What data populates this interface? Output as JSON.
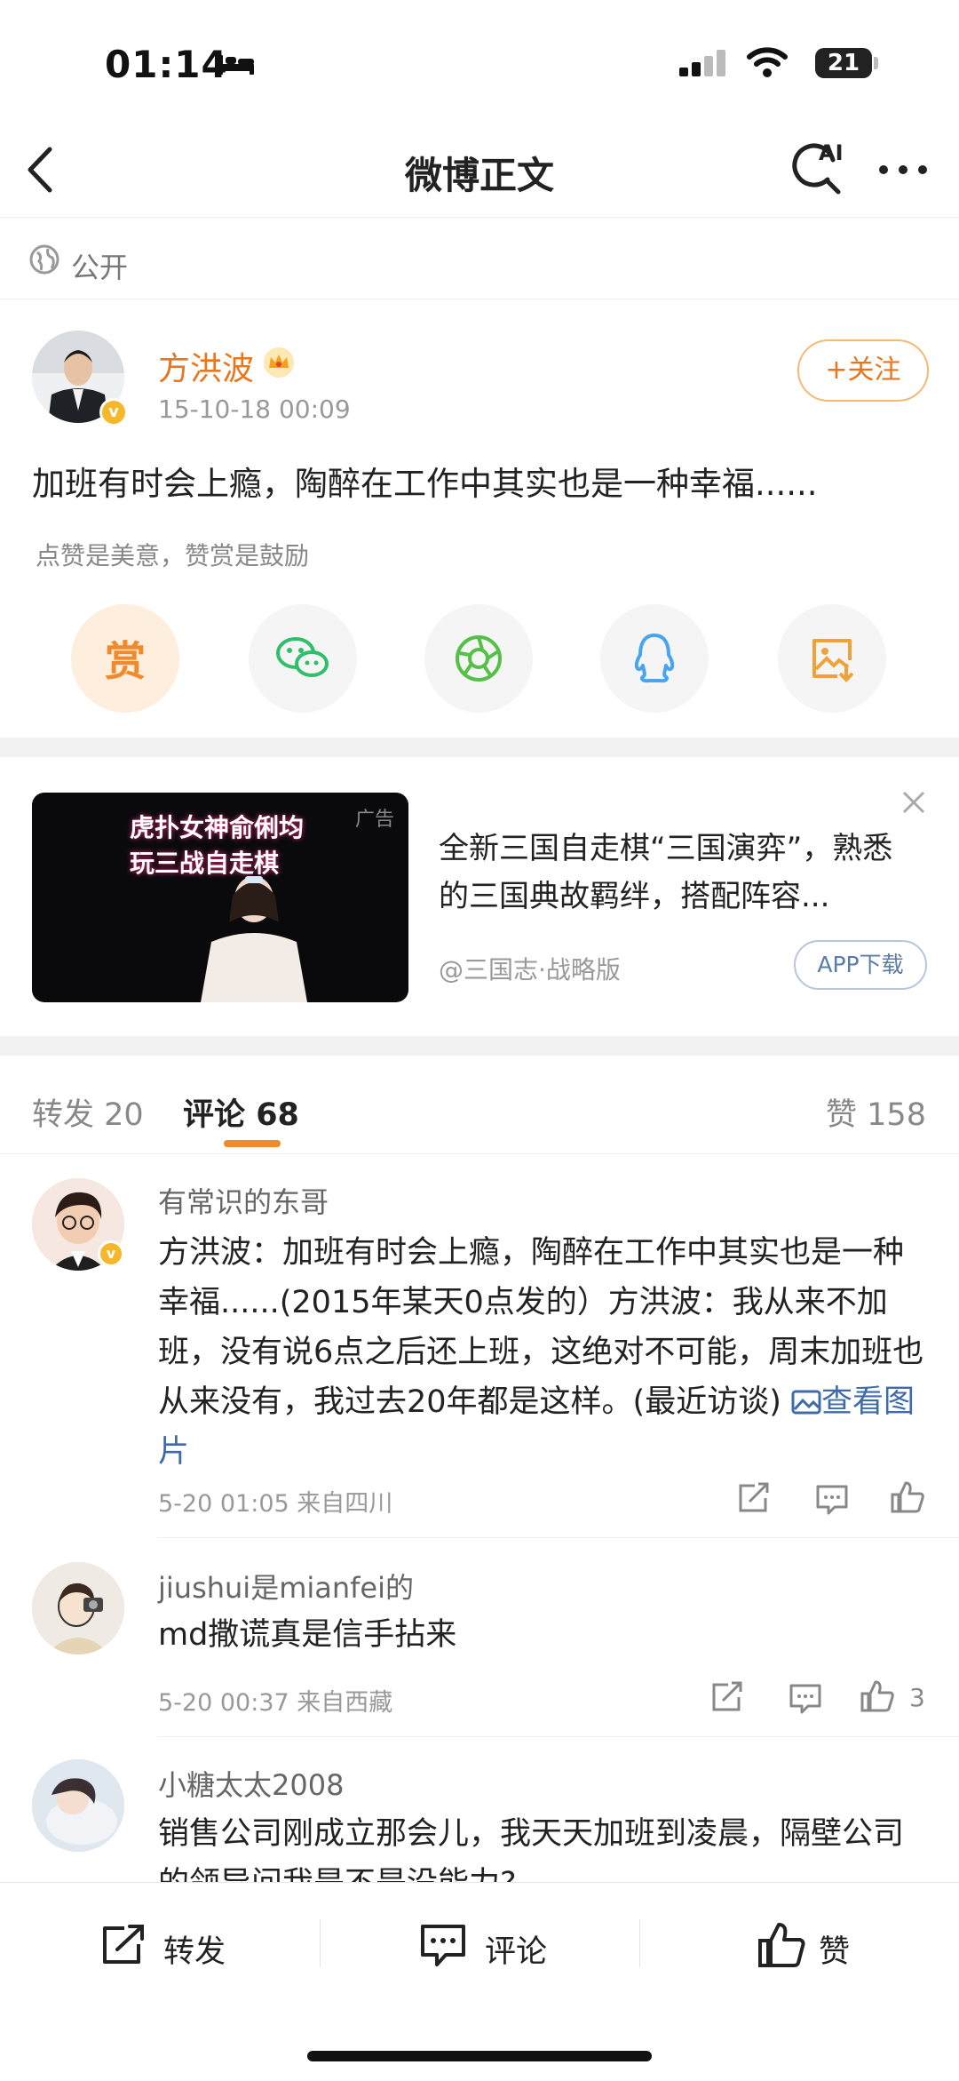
{
  "status_bar": {
    "time": "01:14",
    "battery": "21"
  },
  "nav": {
    "title": "微博正文",
    "ai_label": "AI"
  },
  "visibility": {
    "label": "公开"
  },
  "post": {
    "author": "方洪波",
    "timestamp": "15-10-18 00:09",
    "follow_label": "+关注",
    "text": "加班有时会上瘾，陶醉在工作中其实也是一种幸福......",
    "reward_hint": "点赞是美意，赞赏是鼓励",
    "reward_label": "赏"
  },
  "ad": {
    "image_text_line1": "虎扑女神俞俐均",
    "image_text_line2": "玩三战自走棋",
    "badge": "广告",
    "text": "全新三国自走棋“三国演弈”，熟悉的三国典故羁绊，搭配阵容...",
    "source": "@三国志·战略版",
    "button": "APP下载"
  },
  "tabs": {
    "repost_label": "转发",
    "repost_count": "20",
    "comment_label": "评论",
    "comment_count": "68",
    "like_label": "赞",
    "like_count": "158"
  },
  "comments": [
    {
      "name": "有常识的东哥",
      "text": "方洪波：加班有时会上瘾，陶醉在工作中其实也是一种幸福......(2015年某天0点发的）方洪波：我从来不加班，没有说6点之后还上班，这绝对不可能，周末加班也从来没有，我过去20年都是这样。(最近访谈)",
      "link": "查看图片",
      "meta": "5-20 01:05 来自四川",
      "likes": ""
    },
    {
      "name": "jiushui是mianfei的",
      "text": "md撒谎真是信手拈来",
      "meta": "5-20 00:37 来自西藏",
      "likes": "3"
    },
    {
      "name": "小糖太太2008",
      "text": "销售公司刚成立那会儿，我天天加班到凌晨，隔壁公司的领导问我是不是没能力?"
    }
  ],
  "bottom_bar": {
    "repost": "转发",
    "comment": "评论",
    "like": "赞"
  },
  "colors": {
    "accent": "#e8761c",
    "link": "#3f6ca8",
    "wechat": "#2fbf6a",
    "moments": "#55c046",
    "qq": "#4aa3ee",
    "save": "#f0a23a"
  }
}
